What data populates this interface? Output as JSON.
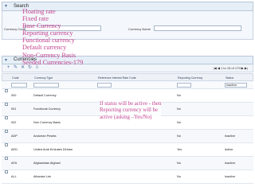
{
  "search": {
    "title": "Search",
    "currency_code_label": "Currency Code",
    "currency_name_label": "Currency Name",
    "currency_code_value": "",
    "currency_name_value": ""
  },
  "grid": {
    "title": "Currencies",
    "pager_text": "1 to 15 of 179",
    "columns": {
      "code": "Code",
      "type": "Currency Type",
      "rate_code": "Reference Interest Rate Code",
      "reporting": "Reporting Currency",
      "status": "Status"
    },
    "filter_status_value": "Inactive",
    "rows": [
      {
        "code": "000",
        "type": "Default Currency",
        "reporting": "No",
        "status": ""
      },
      {
        "code": "001",
        "type": "Functional Currency",
        "reporting": "No",
        "status": ""
      },
      {
        "code": "002",
        "type": "Non Currency Basis",
        "reporting": "No",
        "status": ""
      },
      {
        "code": "ADP",
        "type": "Andorran Peseta",
        "reporting": "No",
        "status": "Inactive"
      },
      {
        "code": "AED",
        "type": "United Arab Emirates Dirham",
        "reporting": "Yes",
        "status": "Active"
      },
      {
        "code": "AFA",
        "type": "Afghanistan Afghani",
        "reporting": "No",
        "status": "Inactive"
      },
      {
        "code": "ALL",
        "type": "Albanian Lek",
        "reporting": "No",
        "status": "Inactive"
      }
    ]
  },
  "overlay": {
    "lines": [
      "Floating rate",
      "Fixed rate",
      "Base  Currency",
      "Reporting currency",
      "Functional currency",
      "Default  currency",
      "Non-Currency Basis",
      "Seeded Currencies-179"
    ],
    "note": [
      "If status will be active - then",
      "Reporting currency  will be",
      "active (asking –Yes/No)"
    ]
  },
  "colors": {
    "annotation": "#c4428f",
    "panel_header": "#e6eef7",
    "border": "#b7c7d9"
  }
}
